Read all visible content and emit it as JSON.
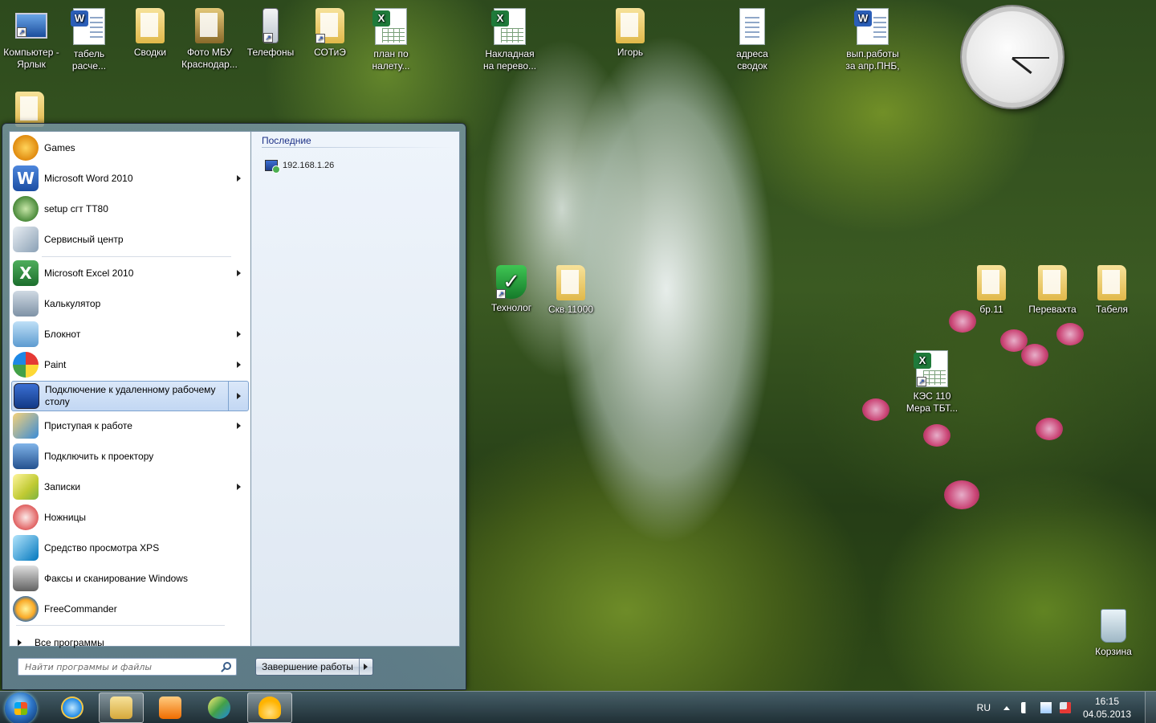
{
  "desktop": {
    "icons": [
      {
        "id": "computer",
        "label": "Компьютер - Ярлык",
        "type": "computer-icon"
      },
      {
        "id": "tabel",
        "label": "табель расче...",
        "type": "word-document-icon"
      },
      {
        "id": "svodki",
        "label": "Сводки",
        "type": "folder-icon"
      },
      {
        "id": "photo",
        "label": "Фото МБУ Краснодар...",
        "type": "folder-icon"
      },
      {
        "id": "phones",
        "label": "Телефоны",
        "type": "phone-icon"
      },
      {
        "id": "sotie",
        "label": "СОТиЭ",
        "type": "folder-icon"
      },
      {
        "id": "plan",
        "label": "план по налету...",
        "type": "excel-document-icon"
      },
      {
        "id": "nakl",
        "label": "Накладная на перево...",
        "type": "excel-document-icon"
      },
      {
        "id": "igor",
        "label": "Игорь",
        "type": "folder-icon"
      },
      {
        "id": "addr",
        "label": "адреса сводок",
        "type": "text-document-icon"
      },
      {
        "id": "vyp",
        "label": "вып.работы за апр.ПНБ,",
        "type": "word-document-icon"
      },
      {
        "id": "tech",
        "label": "Технолог",
        "type": "shield-icon"
      },
      {
        "id": "skv",
        "label": "Скв.11000",
        "type": "folder-icon"
      },
      {
        "id": "br11",
        "label": "бр.11",
        "type": "folder-icon"
      },
      {
        "id": "perev",
        "label": "Перевахта",
        "type": "folder-icon"
      },
      {
        "id": "tabels",
        "label": "Табеля",
        "type": "folder-icon"
      },
      {
        "id": "kes",
        "label": "КЭС 110 Мера ТБТ...",
        "type": "excel-document-icon"
      },
      {
        "id": "trash",
        "label": "Корзина",
        "type": "recycle-bin-icon"
      }
    ]
  },
  "start_menu": {
    "programs": [
      {
        "label": "Games",
        "icon": "games-icon",
        "submenu": false
      },
      {
        "label": "Microsoft Word 2010",
        "icon": "word-icon",
        "submenu": true
      },
      {
        "label": "setup сгт ТТ80",
        "icon": "setup-icon",
        "submenu": false
      },
      {
        "label": "Сервисный центр",
        "icon": "service-center-icon",
        "submenu": false
      },
      {
        "label": "Microsoft Excel 2010",
        "icon": "excel-icon",
        "submenu": true
      },
      {
        "label": "Калькулятор",
        "icon": "calculator-icon",
        "submenu": false
      },
      {
        "label": "Блокнот",
        "icon": "notepad-icon",
        "submenu": true
      },
      {
        "label": "Paint",
        "icon": "paint-icon",
        "submenu": true
      },
      {
        "label": "Подключение к удаленному рабочему столу",
        "icon": "remote-desktop-icon",
        "submenu": true
      },
      {
        "label": "Приступая к работе",
        "icon": "getting-started-icon",
        "submenu": true
      },
      {
        "label": "Подключить к проектору",
        "icon": "projector-icon",
        "submenu": false
      },
      {
        "label": "Записки",
        "icon": "sticky-notes-icon",
        "submenu": true
      },
      {
        "label": "Ножницы",
        "icon": "scissors-icon",
        "submenu": false
      },
      {
        "label": "Средство просмотра XPS",
        "icon": "xps-viewer-icon",
        "submenu": false
      },
      {
        "label": "Факсы и сканирование Windows",
        "icon": "fax-scan-icon",
        "submenu": false
      },
      {
        "label": "FreeCommander",
        "icon": "freecommander-icon",
        "submenu": false
      }
    ],
    "all_programs": "Все программы",
    "recent_header": "Последние",
    "recent_items": [
      "192.168.1.26"
    ],
    "search_placeholder": "Найти программы и файлы",
    "shutdown_label": "Завершение работы"
  },
  "taskbar": {
    "language": "RU",
    "time": "16:15",
    "date": "04.05.2013"
  },
  "colors": {
    "accent": "#2e77c9",
    "selection": "#c2d7f3",
    "recent_header": "#1e3287"
  }
}
